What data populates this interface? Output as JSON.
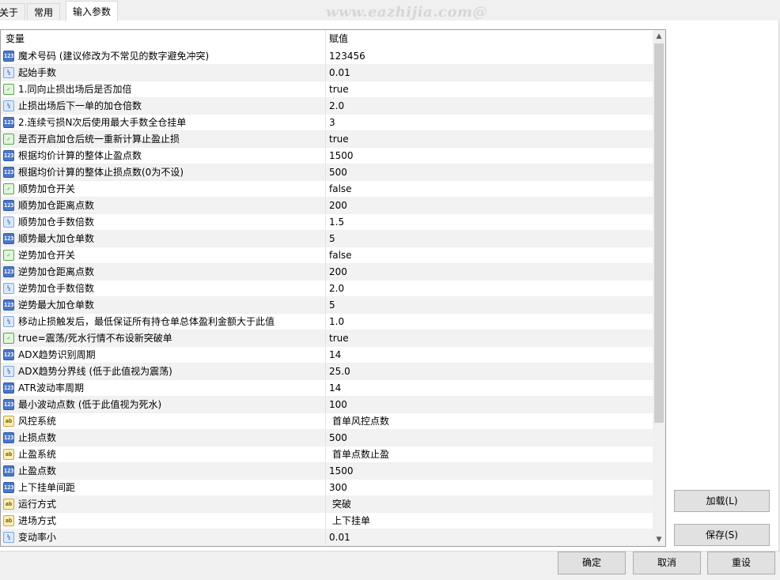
{
  "tabs": [
    {
      "label": "关于"
    },
    {
      "label": "常用"
    },
    {
      "label": "输入参数"
    }
  ],
  "watermark": "www.eazhijia.com@",
  "grid": {
    "header": {
      "variable": "变量",
      "value": "赋值"
    },
    "rows": [
      {
        "icon": "int",
        "name": "魔术号码 (建议修改为不常见的数字避免冲突)",
        "value": "123456"
      },
      {
        "icon": "dbl",
        "name": "起始手数",
        "value": "0.01"
      },
      {
        "icon": "bool",
        "name": "1.同向止损出场后是否加倍",
        "value": "true"
      },
      {
        "icon": "dbl",
        "name": "止损出场后下一单的加仓倍数",
        "value": "2.0"
      },
      {
        "icon": "int",
        "name": "2.连续亏损N次后使用最大手数全仓挂单",
        "value": "3"
      },
      {
        "icon": "bool",
        "name": "是否开启加仓后统一重新计算止盈止损",
        "value": "true"
      },
      {
        "icon": "int",
        "name": "根据均价计算的整体止盈点数",
        "value": "1500"
      },
      {
        "icon": "int",
        "name": "根据均价计算的整体止损点数(0为不设)",
        "value": "500"
      },
      {
        "icon": "bool",
        "name": "顺势加仓开关",
        "value": "false"
      },
      {
        "icon": "int",
        "name": "顺势加仓距离点数",
        "value": "200"
      },
      {
        "icon": "dbl",
        "name": "顺势加仓手数倍数",
        "value": "1.5"
      },
      {
        "icon": "int",
        "name": "顺势最大加仓单数",
        "value": "5"
      },
      {
        "icon": "bool",
        "name": "逆势加仓开关",
        "value": "false"
      },
      {
        "icon": "int",
        "name": "逆势加仓距离点数",
        "value": "200"
      },
      {
        "icon": "dbl",
        "name": "逆势加仓手数倍数",
        "value": "2.0"
      },
      {
        "icon": "int",
        "name": "逆势最大加仓单数",
        "value": "5"
      },
      {
        "icon": "dbl",
        "name": "移动止损触发后，最低保证所有持仓单总体盈利金额大于此值",
        "value": "1.0"
      },
      {
        "icon": "bool",
        "name": "true=震荡/死水行情不布设新突破单",
        "value": "true"
      },
      {
        "icon": "int",
        "name": "ADX趋势识别周期",
        "value": "14"
      },
      {
        "icon": "dbl",
        "name": "ADX趋势分界线 (低于此值视为震荡)",
        "value": "25.0"
      },
      {
        "icon": "int",
        "name": "ATR波动率周期",
        "value": "14"
      },
      {
        "icon": "int",
        "name": "最小波动点数 (低于此值视为死水)",
        "value": "100"
      },
      {
        "icon": "str",
        "name": "风控系统",
        "value": "首单风控点数"
      },
      {
        "icon": "int",
        "name": "止损点数",
        "value": "500"
      },
      {
        "icon": "str",
        "name": "止盈系统",
        "value": "首单点数止盈"
      },
      {
        "icon": "int",
        "name": "止盈点数",
        "value": "1500"
      },
      {
        "icon": "int",
        "name": "上下挂单间距",
        "value": "300"
      },
      {
        "icon": "str",
        "name": "运行方式",
        "value": "突破"
      },
      {
        "icon": "str",
        "name": "进场方式",
        "value": "上下挂单"
      },
      {
        "icon": "dbl",
        "name": "变动率小",
        "value": "0.01"
      }
    ]
  },
  "icon_glyphs": {
    "int": "123",
    "dbl": "½",
    "bool": "✓",
    "str": "ab"
  },
  "buttons": {
    "load": "加载(L)",
    "save": "保存(S)",
    "ok": "确定",
    "cancel": "取消",
    "reset": "重设"
  }
}
